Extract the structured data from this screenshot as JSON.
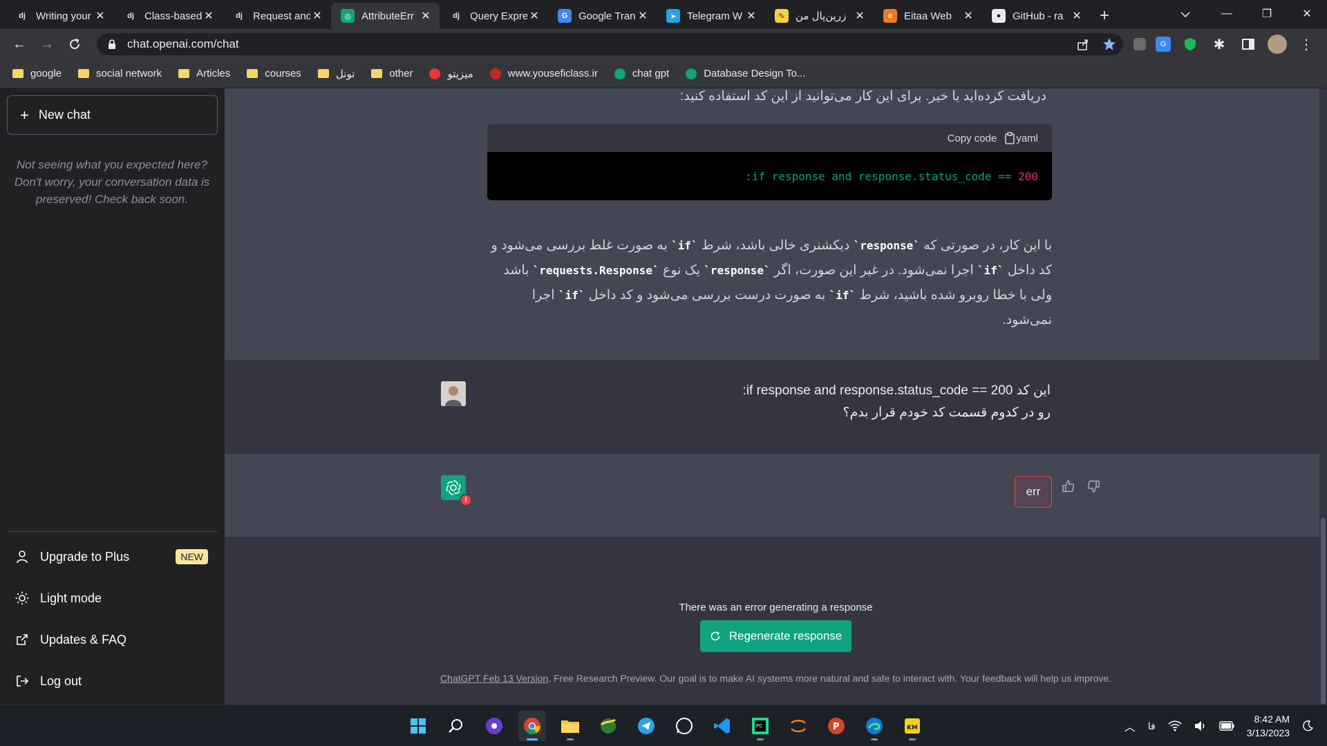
{
  "browser": {
    "tabs": [
      {
        "favicon": "dj",
        "title": "Writing your",
        "active": false
      },
      {
        "favicon": "dj",
        "title": "Class-based",
        "active": false
      },
      {
        "favicon": "dj",
        "title": "Request and",
        "active": false
      },
      {
        "favicon": "openai",
        "title": "AttributeErr",
        "active": true
      },
      {
        "favicon": "dj",
        "title": "Query Expre",
        "active": false
      },
      {
        "favicon": "translate",
        "title": "Google Tran",
        "active": false
      },
      {
        "favicon": "telegram",
        "title": "Telegram W",
        "active": false
      },
      {
        "favicon": "note",
        "title": "زرین‌پال من",
        "active": false
      },
      {
        "favicon": "eitaa",
        "title": "Eitaa Web",
        "active": false
      },
      {
        "favicon": "github",
        "title": "GitHub - ra",
        "active": false
      }
    ],
    "url": "chat.openai.com/chat",
    "bookmarks": [
      {
        "label": "google",
        "icon": "folder"
      },
      {
        "label": "social network",
        "icon": "folder"
      },
      {
        "label": "Articles",
        "icon": "folder"
      },
      {
        "label": "courses",
        "icon": "folder"
      },
      {
        "label": "تونل",
        "icon": "folder"
      },
      {
        "label": "other",
        "icon": "folder"
      },
      {
        "label": "میزیتو",
        "icon": "site"
      },
      {
        "label": "www.youseficlass.ir",
        "icon": "site"
      },
      {
        "label": "chat gpt",
        "icon": "openai"
      },
      {
        "label": "Database Design To...",
        "icon": "site"
      }
    ]
  },
  "sidebar": {
    "new_chat": "New chat",
    "notice": "Not seeing what you expected here? Don't worry, your conversation data is preserved! Check back soon.",
    "items": [
      {
        "label": "Upgrade to Plus",
        "badge": "NEW"
      },
      {
        "label": "Light mode"
      },
      {
        "label": "Updates & FAQ"
      },
      {
        "label": "Log out"
      }
    ]
  },
  "conversation": {
    "assistant_intro": "دریافت کرده‌اید یا خیر. برای این کار می‌توانید از این کد استفاده کنید:",
    "code_block": {
      "copy_label": "Copy code",
      "language": "yaml",
      "code_prefix": ":if response and response.status_code ==",
      "code_number": "200"
    },
    "paragraph": {
      "part1": "با این کار، در صورتی که ",
      "code1": "`response`",
      "part2": " دیکشنری خالی باشد، شرط ",
      "code2": "`if`",
      "part3": " به صورت غلط بررسی می‌شود و کد داخل ",
      "code3": "`if`",
      "part4": " اجرا نمی‌شود. در غیر این صورت، اگر ",
      "code4": "`response`",
      "part5": " یک نوع ",
      "code5": "`requests.Response`",
      "part6": " باشد ولی با خطا روبرو شده باشید، شرط ",
      "code6": "`if`",
      "part7": " به صورت درست بررسی می‌شود و کد داخل ",
      "code7": "`if`",
      "part8": " اجرا نمی‌شود."
    },
    "user_message_line1": "این کد if response and response.status_code == 200:",
    "user_message_line2": "رو در کدوم قسمت کد خودم قرار بدم؟",
    "error_label": "err",
    "error_badge": "!"
  },
  "footer_area": {
    "error_text": "There was an error generating a response",
    "regenerate": "Regenerate response",
    "version_link": "ChatGPT Feb 13 Version",
    "disclaimer": ". Free Research Preview. Our goal is to make AI systems more natural and safe to interact with. Your feedback will help us improve."
  },
  "taskbar": {
    "apps": [
      "start",
      "search",
      "podcast",
      "chrome",
      "file-explorer",
      "browser-globe",
      "telegram",
      "whatsapp",
      "vscode",
      "pycharm",
      "jupyter",
      "powerpoint",
      "edge",
      "kmplayer"
    ],
    "language": "فا",
    "time": "8:42 AM",
    "date": "3/13/2023"
  },
  "colors": {
    "accent": "#10a37f",
    "error": "#ef4146",
    "main_bg": "#343541",
    "assistant_bg": "#444654",
    "sidebar_bg": "#202123"
  }
}
